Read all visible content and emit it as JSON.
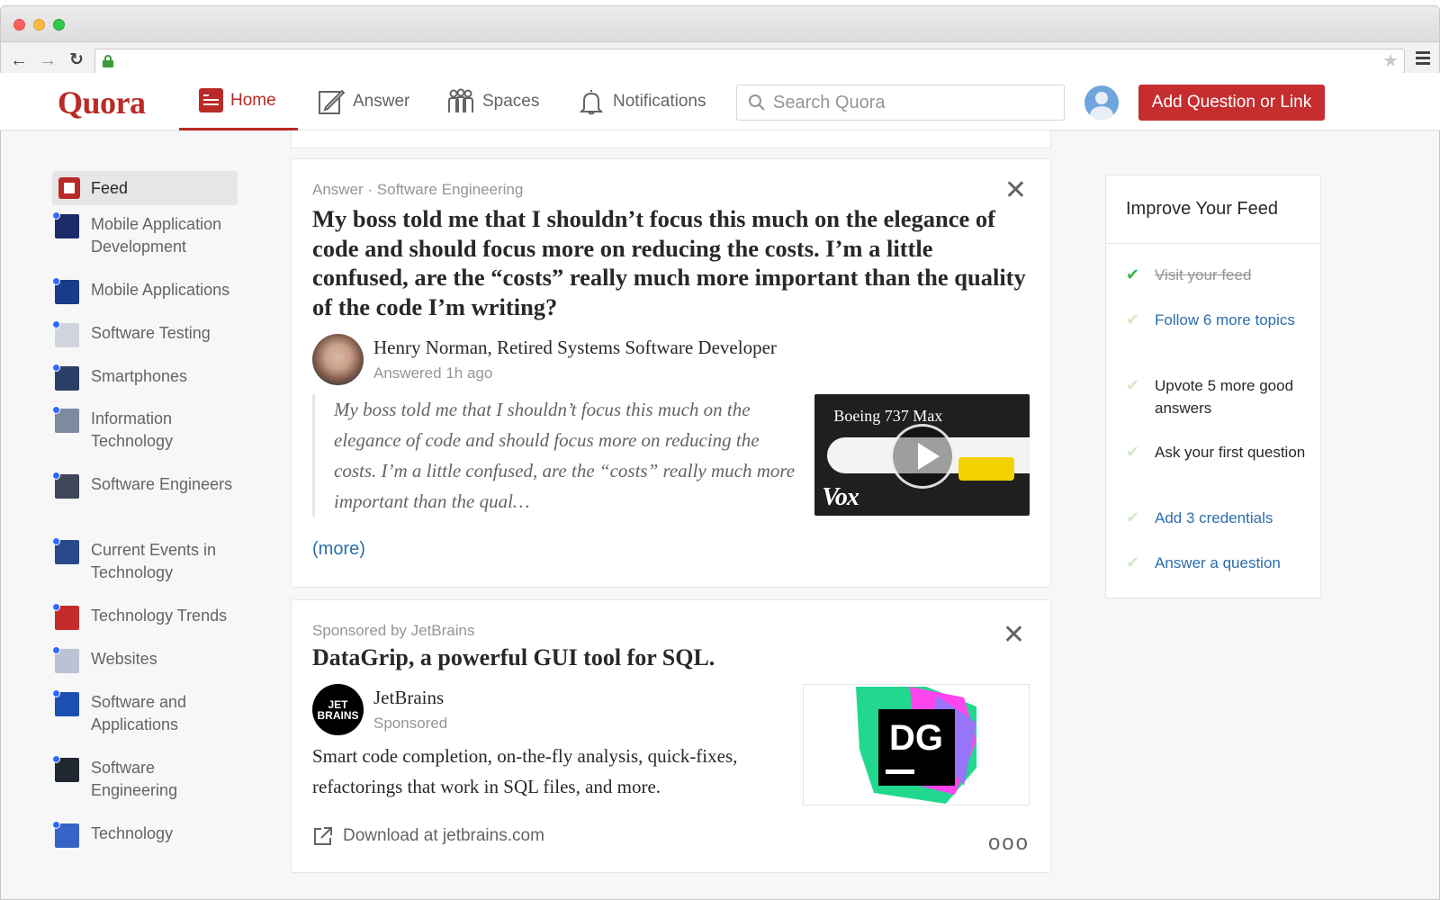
{
  "header": {
    "logo": "Quora",
    "nav": [
      {
        "label": "Home"
      },
      {
        "label": "Answer"
      },
      {
        "label": "Spaces"
      },
      {
        "label": "Notifications"
      }
    ],
    "search_placeholder": "Search Quora",
    "add_button": "Add Question or Link"
  },
  "sidebar": {
    "feed_label": "Feed",
    "topics": [
      {
        "label": "Mobile Application Development",
        "color": "#1d2b6b"
      },
      {
        "label": "Mobile Applications",
        "color": "#1a3a8a"
      },
      {
        "label": "Software Testing",
        "color": "#d0d4dc"
      },
      {
        "label": "Smartphones",
        "color": "#2b3f66"
      },
      {
        "label": "Information Technology",
        "color": "#7d8aa0"
      },
      {
        "label": "Software Engineers",
        "color": "#3e4658"
      },
      {
        "label": "Current Events in Technology",
        "color": "#284a8c"
      },
      {
        "label": "Technology Trends",
        "color": "#c42b2b"
      },
      {
        "label": "Websites",
        "color": "#b9c3d3"
      },
      {
        "label": "Software and Applications",
        "color": "#1b4fb0"
      },
      {
        "label": "Software Engineering",
        "color": "#222831"
      },
      {
        "label": "Technology",
        "color": "#3763c7"
      }
    ]
  },
  "answer_card": {
    "meta": "Answer · Software Engineering",
    "question": "My boss told me that I shouldn’t focus this much on the elegance of code and should focus more on reducing the costs. I’m a little confused, are the “costs” really much more important than the quality of the code I’m writing?",
    "author": "Henry Norman, Retired Systems Software Developer",
    "answered": "Answered 1h ago",
    "excerpt": "My boss told me that I shouldn’t focus this much on the elegance of code and should focus more on reducing the costs. I’m a little confused, are the “costs” really much more important than the qual…",
    "video_title": "Boeing 737 Max",
    "video_brand": "Vox",
    "more": "(more)"
  },
  "ad_card": {
    "meta": "Sponsored by JetBrains",
    "title": "DataGrip, a powerful GUI tool for SQL.",
    "sponsor": "JetBrains",
    "sponsor_logo_line1": "JET",
    "sponsor_logo_line2": "BRAINS",
    "sponsored": "Sponsored",
    "body": "Smart code completion, on-the-fly analysis, quick-fixes, refactorings that work in SQL files, and more.",
    "image_text": "DG",
    "download": "Download at jetbrains.com",
    "more_dots": "ooo"
  },
  "improve_feed": {
    "title": "Improve Your Feed",
    "tasks": [
      {
        "label": "Visit your feed",
        "state": "done"
      },
      {
        "label": "Follow 6 more topics",
        "state": "link"
      },
      {
        "label": "Upvote 5 more good answers",
        "state": "plain"
      },
      {
        "label": "Ask your first question",
        "state": "plain"
      },
      {
        "label": "Add 3 credentials",
        "state": "link"
      },
      {
        "label": "Answer a question",
        "state": "link"
      }
    ]
  },
  "colors": {
    "brand_red": "#b92b27",
    "link_blue": "#2b6dad",
    "check_green": "#3bb54a"
  }
}
